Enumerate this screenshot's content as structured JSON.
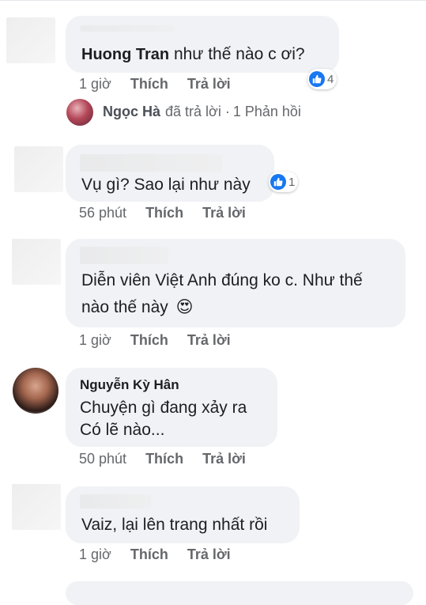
{
  "comments": [
    {
      "author": "Huong Tran",
      "text": "như thế nào c ơi?",
      "time": "1 giờ",
      "like_label": "Thích",
      "reply_label": "Trả lời",
      "reactions": "4"
    },
    {
      "text": "Vụ gì? Sao lại như này",
      "time": "56 phút",
      "like_label": "Thích",
      "reply_label": "Trả lời",
      "reactions": "1"
    },
    {
      "text_line1": "Diễn viên Việt Anh đúng ko c. Như thế",
      "text_line2": "nào thế này",
      "emoji": "😍",
      "time": "1 giờ",
      "like_label": "Thích",
      "reply_label": "Trả lời"
    },
    {
      "author": "Nguyễn Kỳ Hân",
      "text_line1": "Chuyện gì đang xảy ra",
      "text_line2": "Có lẽ nào...",
      "time": "50 phút",
      "like_label": "Thích",
      "reply_label": "Trả lời"
    },
    {
      "text": "Vaiz, lại lên trang nhất rồi",
      "time": "1 giờ",
      "like_label": "Thích",
      "reply_label": "Trả lời"
    }
  ],
  "reply_summary": {
    "name": "Ngọc Hà",
    "action": "đã trả lời",
    "separator": "·",
    "count": "1 Phản hồi"
  },
  "colors": {
    "bubble": "#f0f2f5",
    "meta": "#65676b",
    "like_blue": "#1877f2"
  },
  "icons": [
    "like-icon",
    "heart-eyes-emoji"
  ]
}
